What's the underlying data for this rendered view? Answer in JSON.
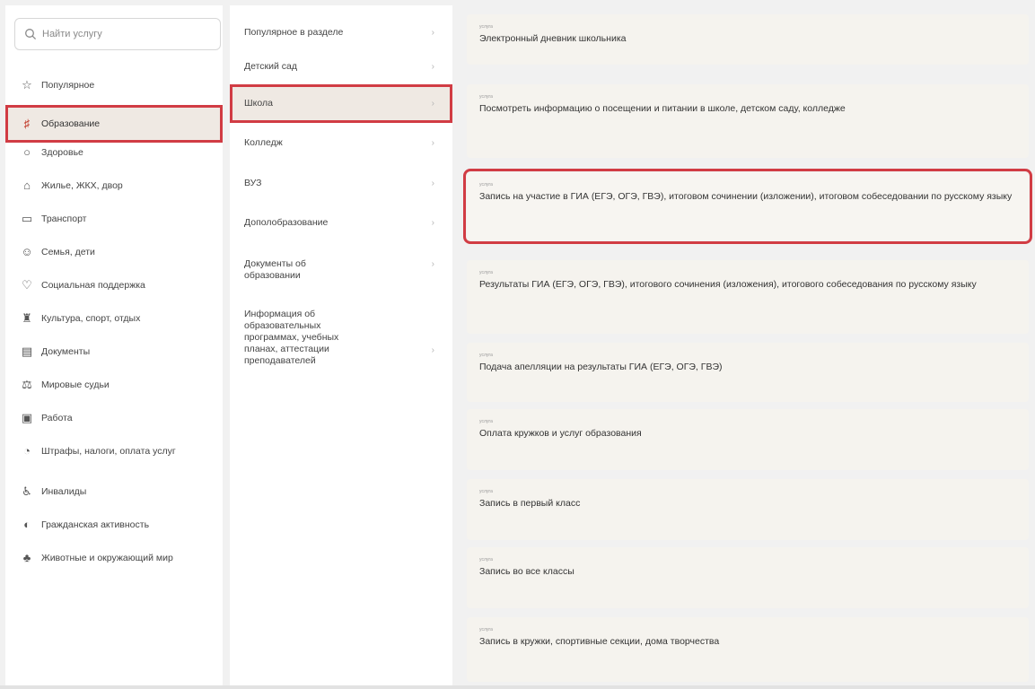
{
  "search": {
    "placeholder": "Найти услугу"
  },
  "categories": [
    {
      "label": "Популярное",
      "icon": "star-icon"
    },
    {
      "label": "Образование",
      "icon": "education-icon",
      "active": true
    },
    {
      "label": "Здоровье",
      "icon": "health-icon"
    },
    {
      "label": "Жилье, ЖКХ, двор",
      "icon": "home-icon"
    },
    {
      "label": "Транспорт",
      "icon": "transport-icon"
    },
    {
      "label": "Семья, дети",
      "icon": "family-icon"
    },
    {
      "label": "Социальная поддержка",
      "icon": "heart-icon"
    },
    {
      "label": "Культура, спорт, отдых",
      "icon": "culture-icon"
    },
    {
      "label": "Документы",
      "icon": "document-icon"
    },
    {
      "label": "Мировые судьи",
      "icon": "justice-icon"
    },
    {
      "label": "Работа",
      "icon": "briefcase-icon"
    },
    {
      "label": "Штрафы, налоги, оплата услуг",
      "icon": "wallet-icon"
    },
    {
      "label": "Инвалиды",
      "icon": "accessibility-icon"
    },
    {
      "label": "Гражданская активность",
      "icon": "activity-icon"
    },
    {
      "label": "Животные и окружающий мир",
      "icon": "nature-icon"
    }
  ],
  "subcategories": [
    {
      "label": "Популярное в разделе"
    },
    {
      "label": "Детский сад"
    },
    {
      "label": "Школа",
      "active": true
    },
    {
      "label": "Колледж"
    },
    {
      "label": "ВУЗ"
    },
    {
      "label": "Дополобразование"
    },
    {
      "label": "Документы об образовании"
    },
    {
      "label": "Информация об образовательных программах, учебных планах, аттестации преподавателей"
    }
  ],
  "services": [
    {
      "caption": "услуга",
      "title": "Электронный дневник школьника"
    },
    {
      "caption": "услуга",
      "title": "Посмотреть информацию о посещении и питании в школе, детском саду, колледже"
    },
    {
      "caption": "услуга",
      "title": "Запись на участие в ГИА (ЕГЭ, ОГЭ, ГВЭ), итоговом сочинении (изложении), итоговом собеседовании по русскому языку",
      "highlighted": true
    },
    {
      "caption": "услуга",
      "title": "Результаты ГИА (ЕГЭ, ОГЭ, ГВЭ), итогового сочинения (изложения), итогового собеседования по русскому языку"
    },
    {
      "caption": "услуга",
      "title": "Подача апелляции на результаты ГИА (ЕГЭ, ОГЭ, ГВЭ)"
    },
    {
      "caption": "услуга",
      "title": "Оплата кружков и услуг образования"
    },
    {
      "caption": "услуга",
      "title": "Запись в первый класс"
    },
    {
      "caption": "услуга",
      "title": "Запись во все классы"
    },
    {
      "caption": "услуга",
      "title": "Запись в кружки, спортивные секции, дома творчества"
    }
  ],
  "colors": {
    "accent_outline": "#d13c44",
    "active_bg": "#efe9e3",
    "card_bg": "#f5f3ee"
  }
}
